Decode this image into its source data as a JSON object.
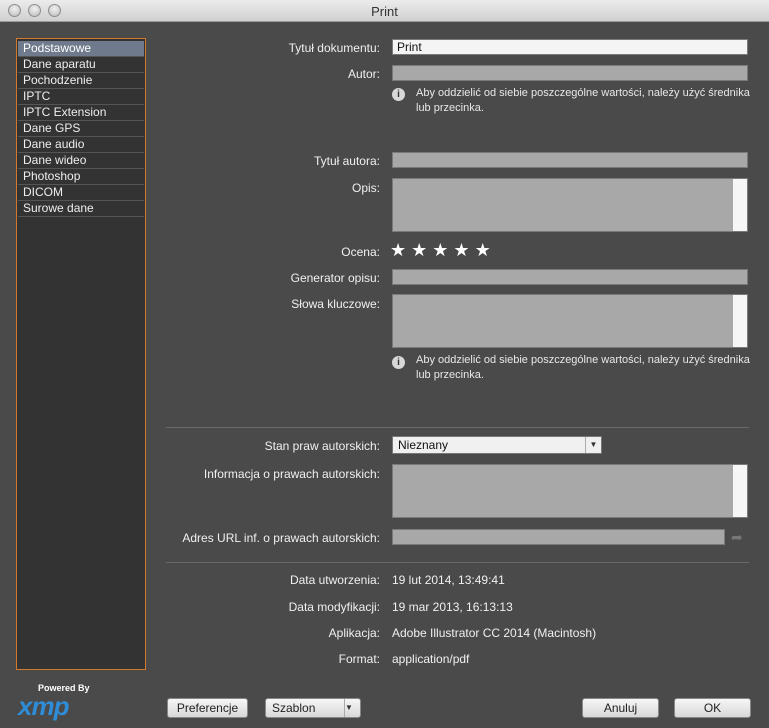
{
  "window": {
    "title": "Print"
  },
  "sidebar": {
    "items": [
      {
        "label": "Podstawowe"
      },
      {
        "label": "Dane aparatu"
      },
      {
        "label": "Pochodzenie"
      },
      {
        "label": "IPTC"
      },
      {
        "label": "IPTC Extension"
      },
      {
        "label": "Dane GPS"
      },
      {
        "label": "Dane audio"
      },
      {
        "label": "Dane wideo"
      },
      {
        "label": "Photoshop"
      },
      {
        "label": "DICOM"
      },
      {
        "label": "Surowe dane"
      }
    ],
    "active_index": 0
  },
  "branding": {
    "powered_by": "Powered By",
    "logo_text": "xmp"
  },
  "form": {
    "doc_title_label": "Tytuł dokumentu:",
    "doc_title_value": "Print",
    "author_label": "Autor:",
    "author_value": "",
    "hint_text": "Aby oddzielić od siebie poszczególne wartości, należy użyć średnika lub przecinka.",
    "author_title_label": "Tytuł autora:",
    "description_label": "Opis:",
    "rating_label": "Ocena:",
    "rating_stars": 5,
    "description_writer_label": "Generator opisu:",
    "keywords_label": "Słowa kluczowe:",
    "copyright_status_label": "Stan praw autorskich:",
    "copyright_status_value": "Nieznany",
    "copyright_notice_label": "Informacja o prawach autorskich:",
    "copyright_url_label": "Adres URL inf. o prawach autorskich:"
  },
  "meta": {
    "created_label": "Data utworzenia:",
    "created_value": "19 lut 2014, 13:49:41",
    "modified_label": "Data modyfikacji:",
    "modified_value": "19 mar 2013, 16:13:13",
    "app_label": "Aplikacja:",
    "app_value": "Adobe Illustrator CC 2014 (Macintosh)",
    "format_label": "Format:",
    "format_value": "application/pdf"
  },
  "buttons": {
    "preferences": "Preferencje",
    "template": "Szablon",
    "cancel": "Anuluj",
    "ok": "OK"
  }
}
